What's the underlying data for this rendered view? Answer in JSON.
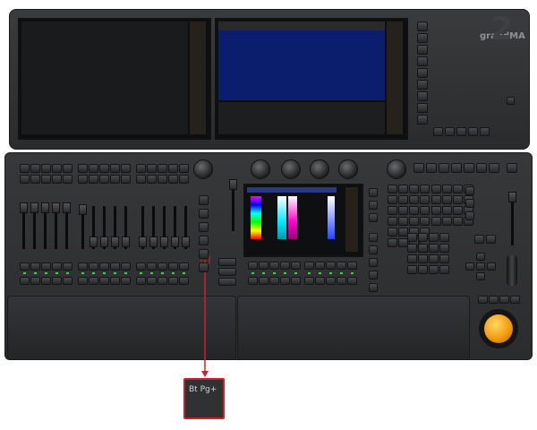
{
  "product": {
    "brand": "grandMA",
    "model_mark": "2"
  },
  "callout": {
    "key_label": "Bt Pg+",
    "arrow_color": "#c8232c"
  },
  "colors": {
    "body": "#2d2e30",
    "trackball": "#f29c0e",
    "screen_accent_blue": "#1f5fd8",
    "highlight": "#c8232c"
  },
  "icons": [
    "encoder-knob",
    "fader",
    "trackball",
    "display-screen"
  ]
}
